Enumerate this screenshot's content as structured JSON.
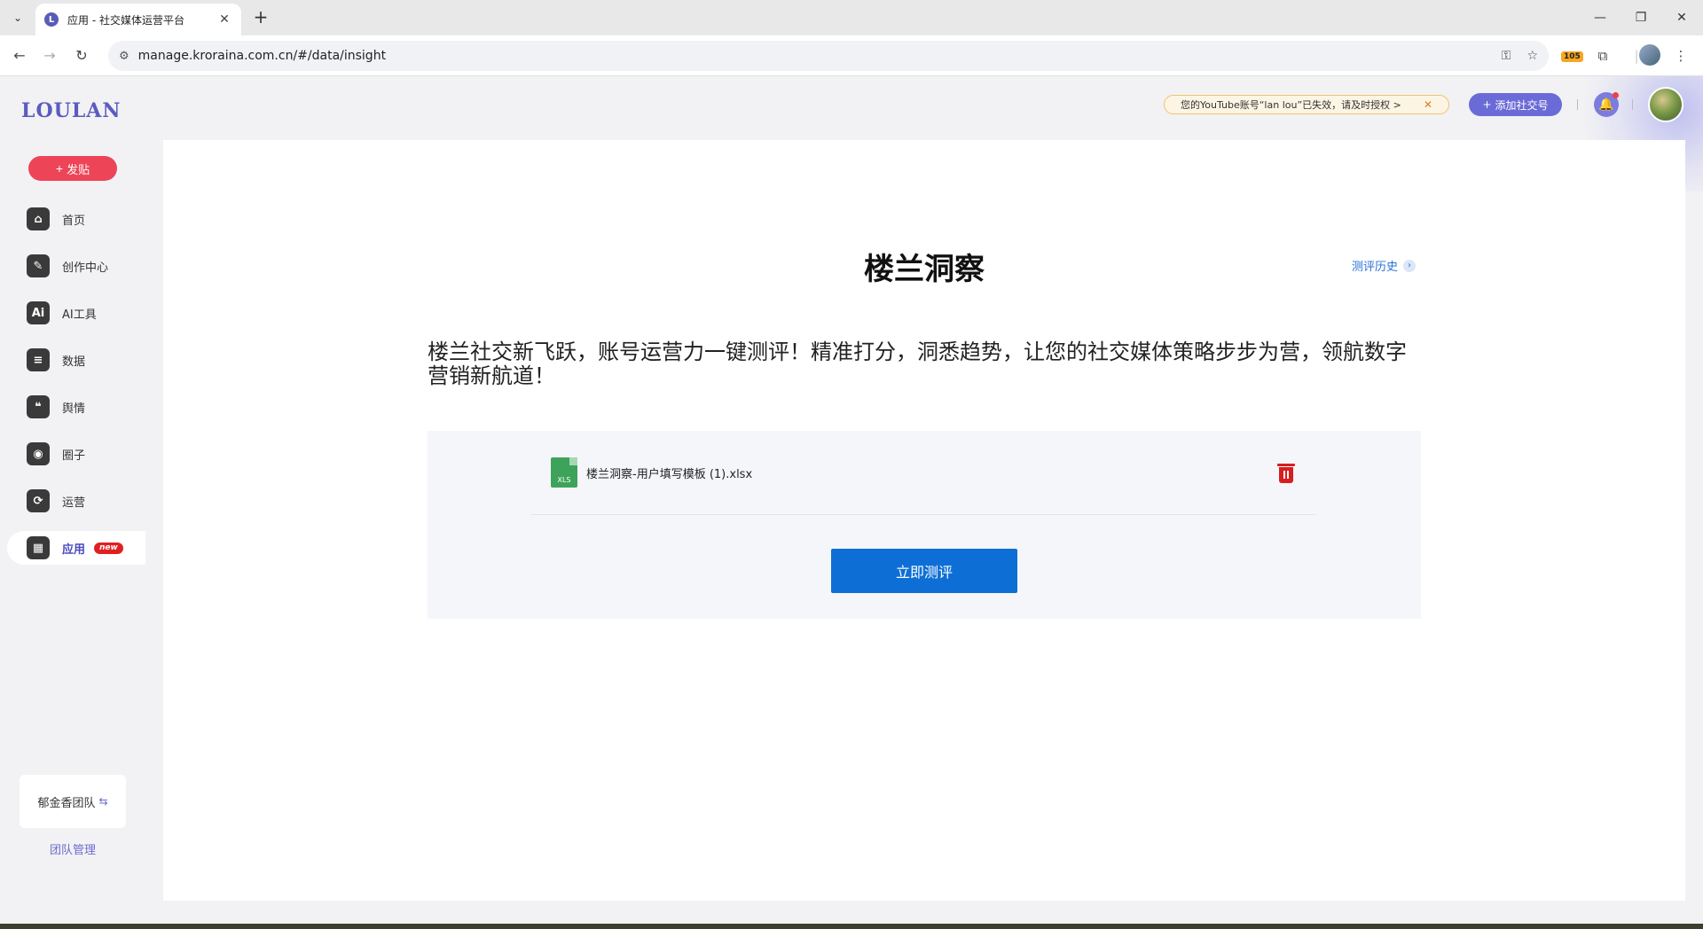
{
  "browser": {
    "tab_title": "应用 - 社交媒体运营平台",
    "tab_favicon": "L",
    "url": "manage.kroraina.com.cn/#/data/insight",
    "extension_badge": "105"
  },
  "sidebar": {
    "logo": "LOULAN",
    "post_button": "发贴",
    "items": [
      {
        "label": "首页",
        "icon": "home-icon",
        "glyph": "⌂"
      },
      {
        "label": "创作中心",
        "icon": "palette-icon",
        "glyph": "✎"
      },
      {
        "label": "AI工具",
        "icon": "ai-icon",
        "glyph": "Ai"
      },
      {
        "label": "数据",
        "icon": "database-icon",
        "glyph": "≡"
      },
      {
        "label": "舆情",
        "icon": "quote-icon",
        "glyph": "❝"
      },
      {
        "label": "圈子",
        "icon": "compass-icon",
        "glyph": "◉"
      },
      {
        "label": "运营",
        "icon": "network-icon",
        "glyph": "⟳"
      },
      {
        "label": "应用",
        "icon": "apps-icon",
        "glyph": "▦",
        "badge": "new"
      }
    ],
    "team_name": "郁金香团队",
    "team_mgmt": "团队管理"
  },
  "header": {
    "notice": "您的YouTube账号“lan lou”已失效，请及时授权 >",
    "add_account": "添加社交号"
  },
  "main": {
    "title": "楼兰洞察",
    "history_link": "测评历史",
    "description": "楼兰社交新飞跃，账号运营力一键测评！精准打分，洞悉趋势，让您的社交媒体策略步步为营，领航数字营销新航道！",
    "file_name": "楼兰洞察-用户填写模板 (1).xlsx",
    "file_type": "XLS",
    "evaluate_button": "立即测评"
  },
  "colors": {
    "accent": "#6b6bd8",
    "post_button": "#ee4457",
    "primary_button": "#0d6fd6",
    "delete": "#d81e1e"
  }
}
